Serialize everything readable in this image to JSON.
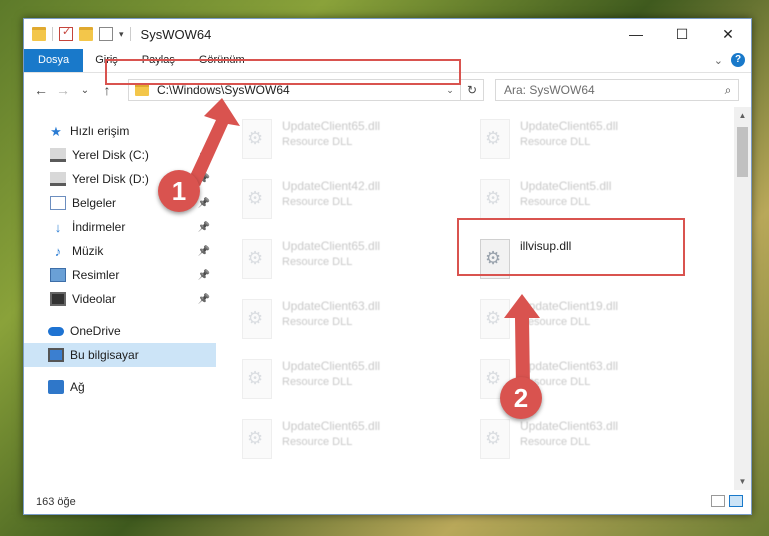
{
  "titlebar": {
    "title": "SysWOW64",
    "icons": [
      "folder-icon",
      "checkmark-icon",
      "folder-icon",
      "properties-icon"
    ]
  },
  "window_controls": {
    "minimize": "—",
    "maximize": "☐",
    "close": "✕"
  },
  "ribbon": {
    "tabs": [
      "Dosya",
      "Giriş",
      "Paylaş",
      "Görünüm"
    ],
    "expand": "⌄",
    "help": "?"
  },
  "nav": {
    "back": "←",
    "forward": "→",
    "recent": "⌄",
    "up": "↑"
  },
  "address": {
    "path": "C:\\Windows\\SysWOW64",
    "refresh": "↻"
  },
  "search": {
    "placeholder": "Ara: SysWOW64"
  },
  "sidebar": {
    "items": [
      {
        "label": "Hızlı erişim",
        "icon": "star-icon"
      },
      {
        "label": "Yerel Disk (C:)",
        "icon": "drive-icon",
        "pinned": true
      },
      {
        "label": "Yerel Disk (D:)",
        "icon": "drive-icon",
        "pinned": true
      },
      {
        "label": "Belgeler",
        "icon": "documents-icon",
        "pinned": true
      },
      {
        "label": "İndirmeler",
        "icon": "download-icon",
        "pinned": true
      },
      {
        "label": "Müzik",
        "icon": "music-icon",
        "pinned": true
      },
      {
        "label": "Resimler",
        "icon": "pictures-icon",
        "pinned": true
      },
      {
        "label": "Videolar",
        "icon": "videos-icon",
        "pinned": true
      },
      {
        "label": "OneDrive",
        "icon": "cloud-icon"
      },
      {
        "label": "Bu bilgisayar",
        "icon": "computer-icon",
        "selected": true
      },
      {
        "label": "Ağ",
        "icon": "network-icon"
      }
    ]
  },
  "files": [
    {
      "name": "UpdateClient65.dll",
      "desc": "Resource DLL"
    },
    {
      "name": "UpdateClient65.dll",
      "desc": "Resource DLL"
    },
    {
      "name": "UpdateClient42.dll",
      "desc": "Resource DLL"
    },
    {
      "name": "UpdateClient5.dll",
      "desc": "Resource DLL"
    },
    {
      "name": "UpdateClient65.dll",
      "desc": "Resource DLL"
    },
    {
      "name": "illvisup.dll",
      "desc": ""
    },
    {
      "name": "UpdateClient63.dll",
      "desc": "Resource DLL"
    },
    {
      "name": "UpdateClient19.dll",
      "desc": "Resource DLL"
    },
    {
      "name": "UpdateClient65.dll",
      "desc": "Resource DLL"
    },
    {
      "name": "UpdateClient63.dll",
      "desc": "Resource DLL"
    },
    {
      "name": "UpdateClient65.dll",
      "desc": "Resource DLL"
    },
    {
      "name": "UpdateClient63.dll",
      "desc": "Resource DLL"
    }
  ],
  "status": {
    "count": "163 öğe"
  },
  "markers": [
    "1",
    "2"
  ],
  "colors": {
    "accent": "#1979ca",
    "highlight": "#d9534f",
    "selection": "#cce4f7"
  }
}
